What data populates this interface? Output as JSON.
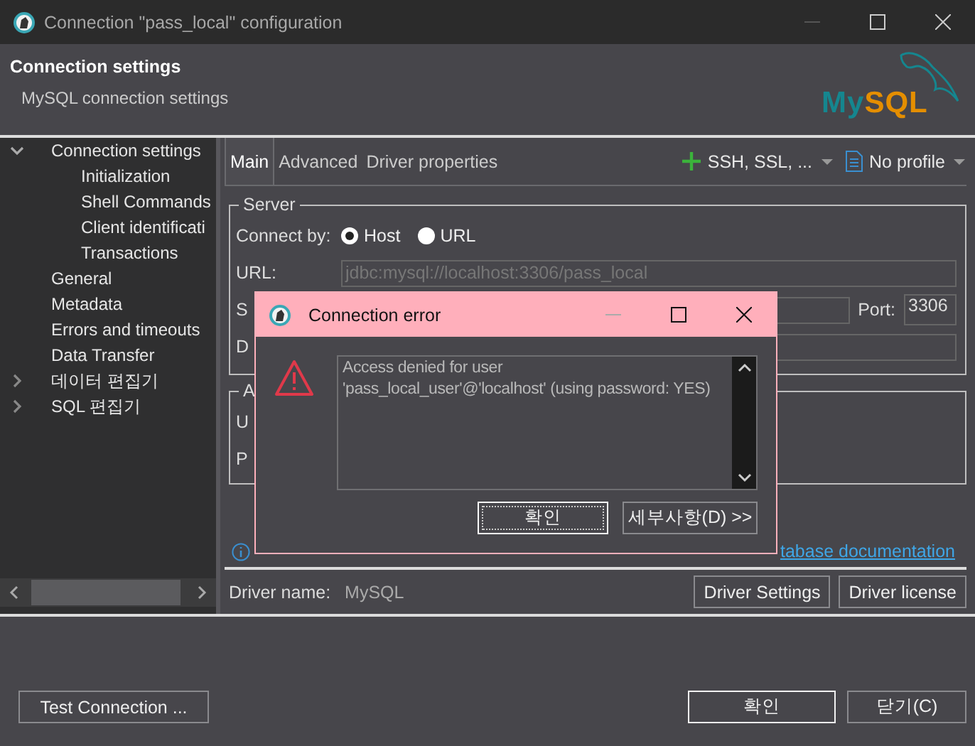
{
  "window": {
    "title": "Connection \"pass_local\" configuration"
  },
  "header": {
    "title": "Connection settings",
    "subtitle": "MySQL connection settings",
    "logo": {
      "prefix": "My",
      "suffix": "SQL"
    }
  },
  "tree": [
    {
      "label": "Connection settings",
      "expanded": true,
      "children": [
        {
          "label": "Initialization"
        },
        {
          "label": "Shell Commands"
        },
        {
          "label": "Client identificati"
        },
        {
          "label": "Transactions"
        }
      ]
    },
    {
      "label": "General"
    },
    {
      "label": "Metadata"
    },
    {
      "label": "Errors and timeouts"
    },
    {
      "label": "Data Transfer"
    },
    {
      "label": "데이터 편집기",
      "expanded": false
    },
    {
      "label": "SQL 편집기",
      "expanded": false
    }
  ],
  "tabs": [
    {
      "label": "Main",
      "selected": true
    },
    {
      "label": "Advanced",
      "selected": false
    },
    {
      "label": "Driver properties",
      "selected": false
    }
  ],
  "toolbar": {
    "network": "SSH, SSL, ...",
    "profile": "No profile"
  },
  "server": {
    "title": "Server",
    "connect_by": "Connect by:",
    "options": [
      {
        "label": "Host",
        "selected": true
      },
      {
        "label": "URL",
        "selected": false
      }
    ],
    "url_label": "URL:",
    "url_value": "jdbc:mysql://localhost:3306/pass_local",
    "host_label": "S",
    "port_label": "Port:",
    "port_value": "3306",
    "database_label": "D"
  },
  "auth": {
    "title": "A",
    "user_label": "U",
    "password_label": "P"
  },
  "doc_link": "tabase documentation",
  "driver": {
    "label": "Driver name:",
    "value": "MySQL",
    "buttons": [
      "Driver Settings",
      "Driver license"
    ]
  },
  "footer": {
    "test_button": "Test Connection ...",
    "buttons": [
      {
        "label": "확인",
        "default": true
      },
      {
        "label": "닫기(C)",
        "default": false
      }
    ]
  },
  "dialog": {
    "title": "Connection error",
    "message": "Access denied for user\n'pass_local_user'@'localhost' (using password: YES)",
    "buttons": [
      {
        "label": "확인",
        "focused": true
      },
      {
        "label": "세부사항(D) >>",
        "focused": false
      }
    ]
  }
}
